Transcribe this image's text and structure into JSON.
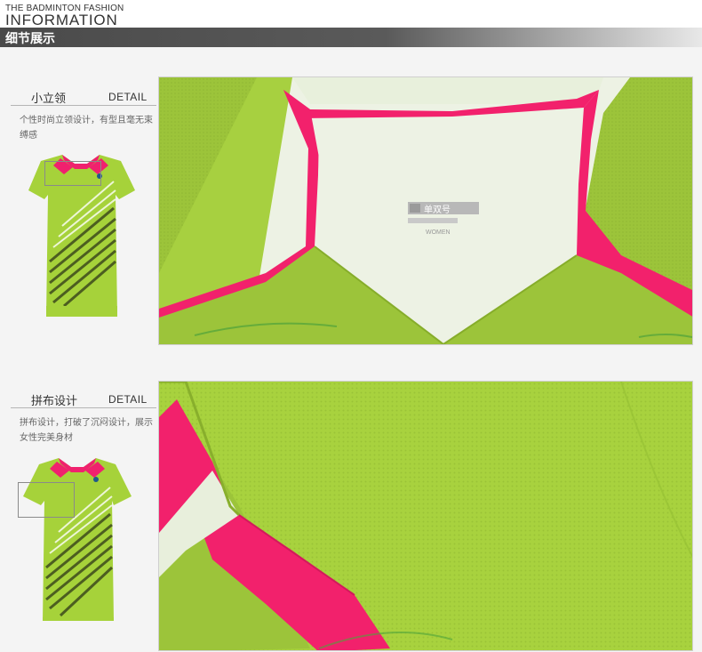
{
  "header": {
    "brand_small": "THE BADMINTON FASHION",
    "brand_big": "INFORMATION",
    "section_title": "细节展示"
  },
  "details": [
    {
      "title": "小立领",
      "label": "DETAIL",
      "description": "个性时尚立领设计，有型且毫无束缚感",
      "photo_alt": "collar close-up",
      "shirt_label_text": "单双号",
      "shirt_label_sub": "WOMEN"
    },
    {
      "title": "拼布设计",
      "label": "DETAIL",
      "description": "拼布设计，打破了沉闷设计，展示女性完美身材",
      "photo_alt": "patchwork close-up"
    }
  ],
  "colors": {
    "lime": "#a6d23a",
    "pink": "#f0216e",
    "bar": "#4a4a4a"
  }
}
